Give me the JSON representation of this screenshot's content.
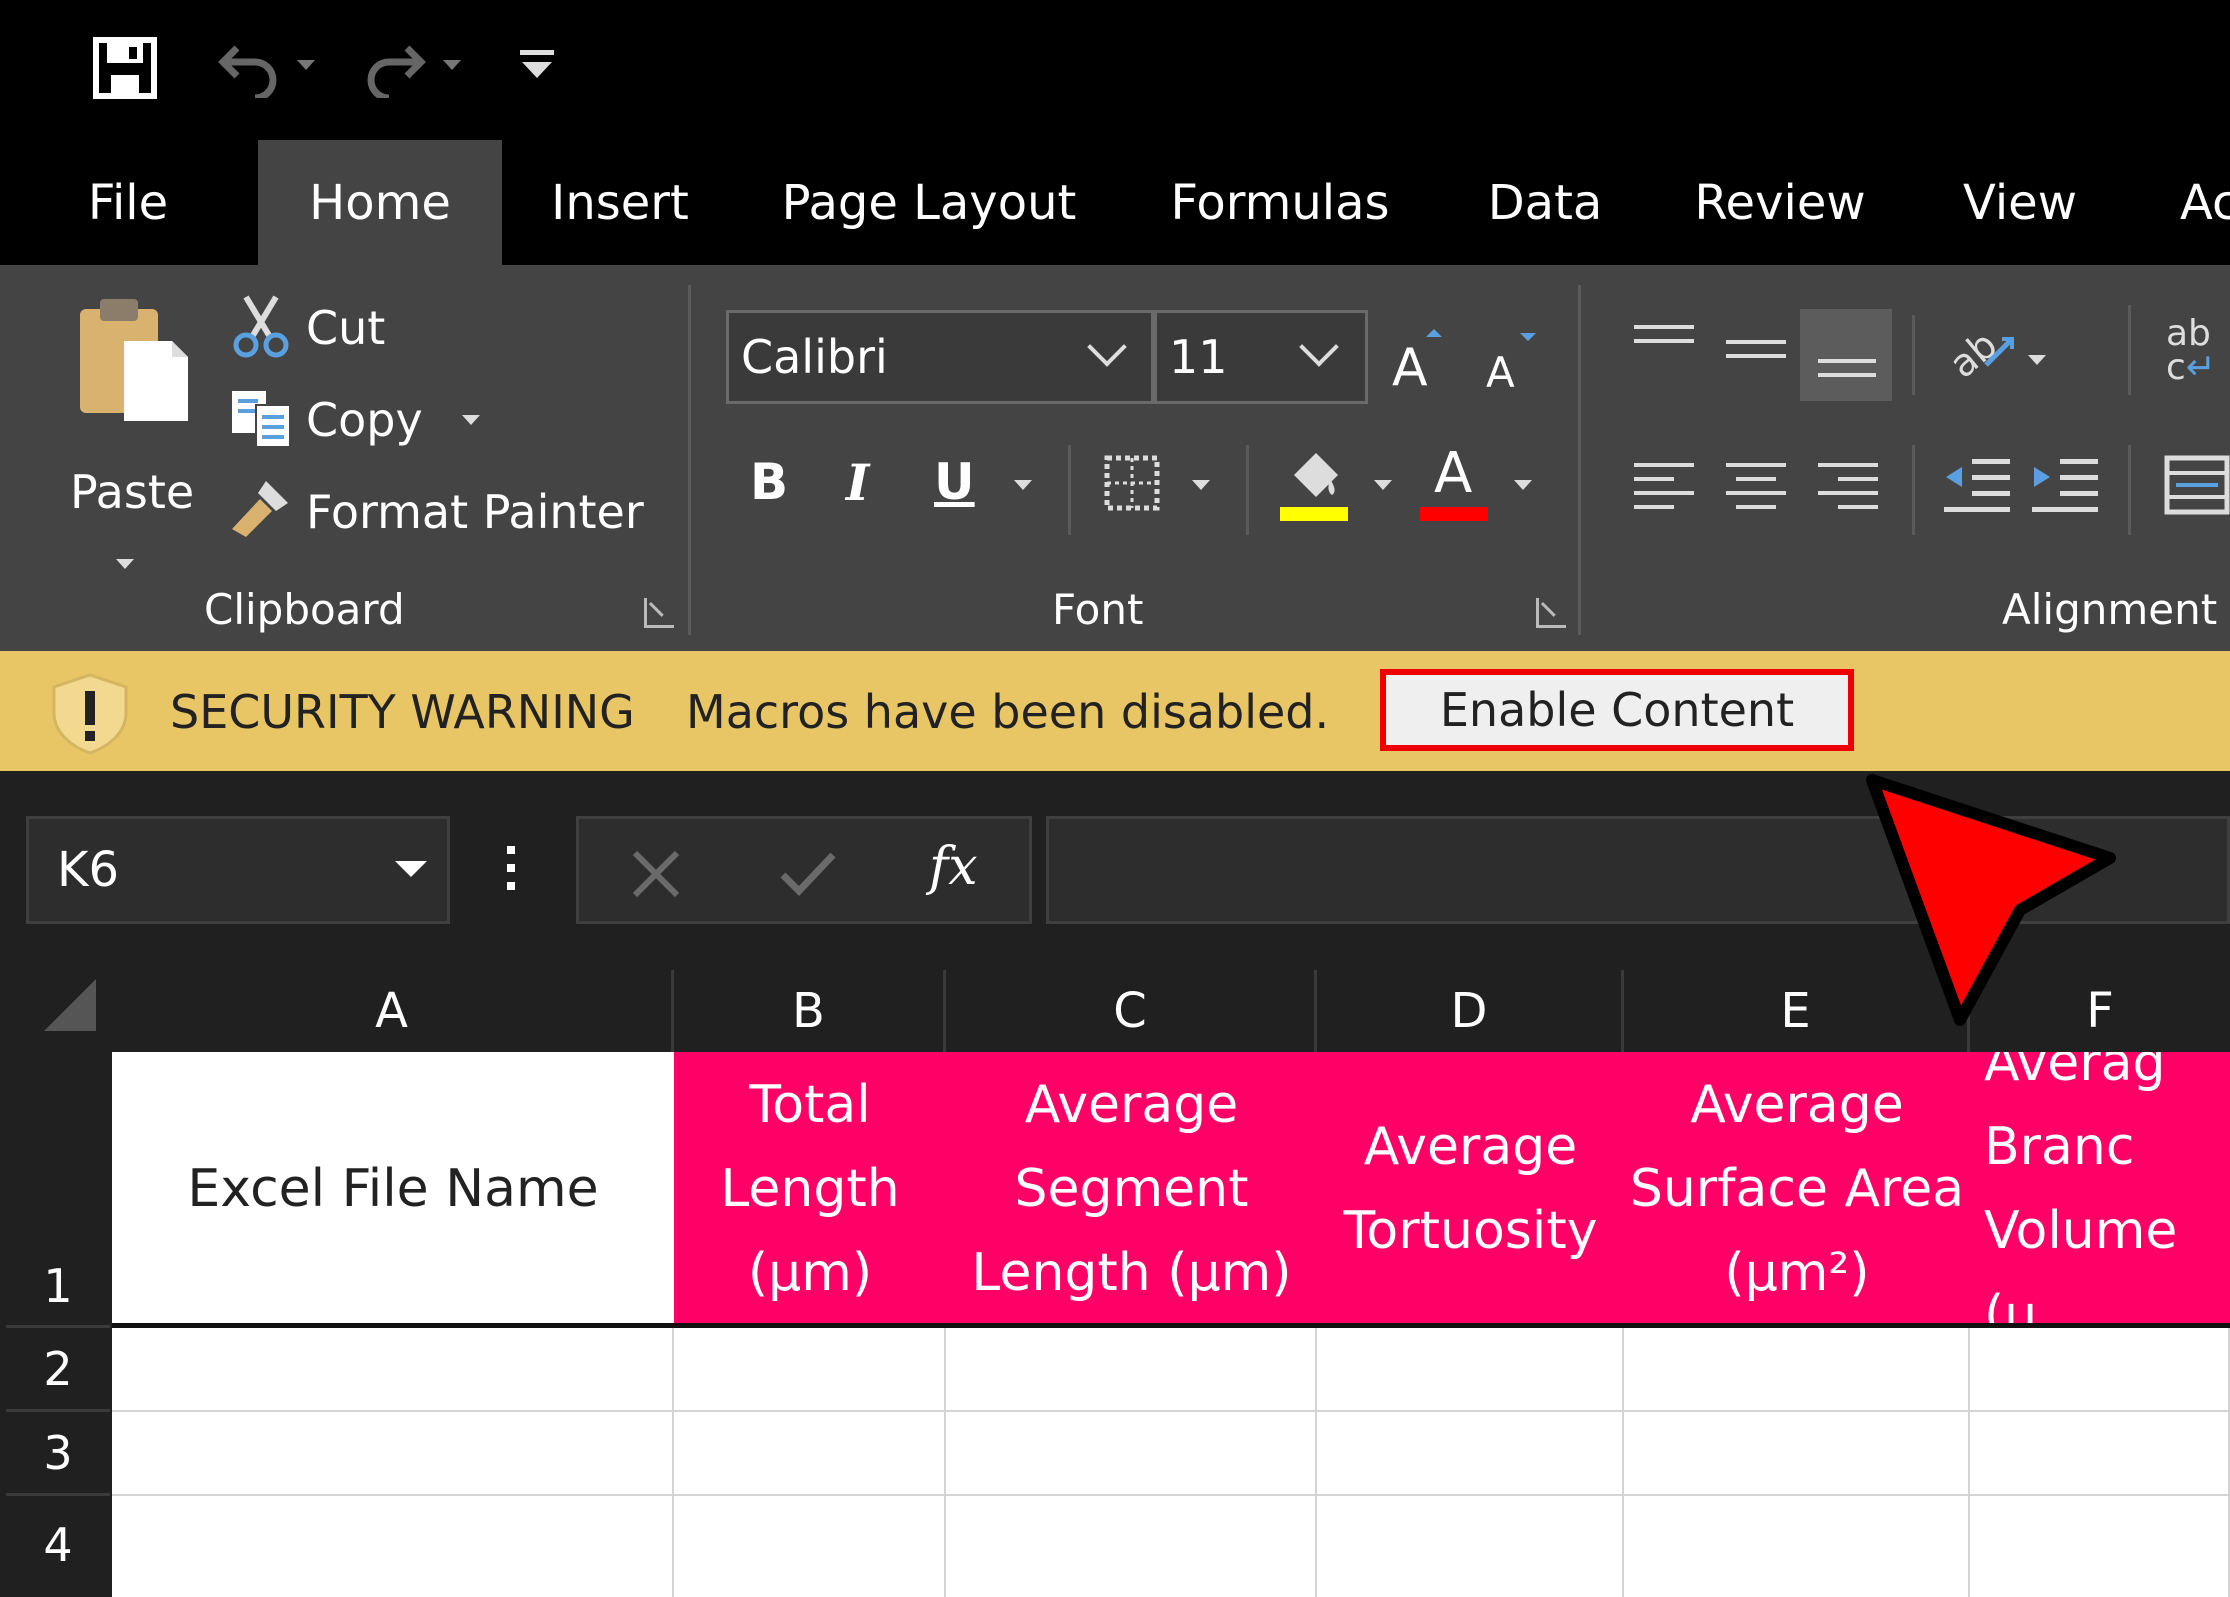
{
  "tabs": [
    "File",
    "Home",
    "Insert",
    "Page Layout",
    "Formulas",
    "Data",
    "Review",
    "View",
    "Ac"
  ],
  "clipboard": {
    "paste_label": "Paste",
    "cut_label": "Cut",
    "copy_label": "Copy",
    "format_painter_label": "Format Painter",
    "group_label": "Clipboard"
  },
  "font": {
    "font_name": "Calibri",
    "font_size": "11",
    "bold": "B",
    "italic": "I",
    "underline": "U",
    "font_color_glyph": "A",
    "group_label": "Font",
    "highlight_color": "#ffff00",
    "font_color": "#ff0000"
  },
  "alignment": {
    "group_label": "Alignment",
    "wrap_glyph": "ab"
  },
  "security": {
    "title": "SECURITY WARNING",
    "message": "Macros have been disabled.",
    "button": "Enable Content"
  },
  "formula_bar": {
    "name_box": "K6",
    "fx": "fx",
    "value": ""
  },
  "grid": {
    "columns": [
      "A",
      "B",
      "C",
      "D",
      "E",
      "F"
    ],
    "rows": [
      "1",
      "2",
      "3",
      "4"
    ],
    "header_cells": [
      "Excel File Name",
      "Total\nLength\n(µm)",
      "Average\nSegment\nLength (µm)",
      "Average\nTortuosity",
      "Average\nSurface Area\n(µm²)",
      "Averag\nBranc\nVolume (µ"
    ],
    "header_fill": "#ff0066"
  }
}
